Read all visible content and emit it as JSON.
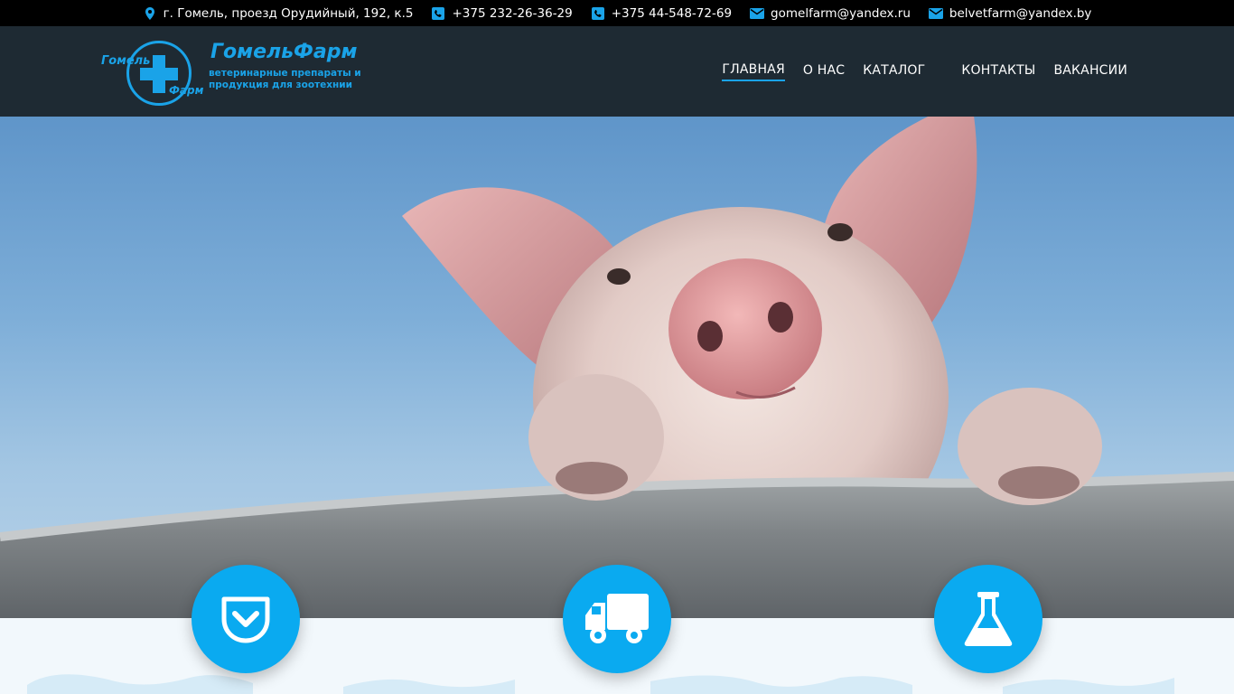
{
  "topbar": {
    "address": "г. Гомель, проезд Орудийный, 192, к.5",
    "phone1": "+375 232-26-36-29",
    "phone2": "+375 44-548-72-69",
    "email1": "gomelfarm@yandex.ru",
    "email2": "belvetfarm@yandex.by",
    "icons": [
      "map-marker-icon",
      "phone-icon",
      "phone-icon",
      "envelope-icon",
      "envelope-icon"
    ]
  },
  "logo": {
    "word_left": "Гомель",
    "word_right": "Фарм",
    "title": "ГомельФарм",
    "subtitle_line1": "ветеринарные препараты и",
    "subtitle_line2": "продукция для зоотехнии"
  },
  "nav": {
    "items": [
      {
        "label": "ГЛАВНАЯ",
        "active": true
      },
      {
        "label": "О НАС",
        "active": false
      },
      {
        "label": "КАТАЛОГ",
        "active": false
      },
      {
        "label": "КОНТАКТЫ",
        "active": false
      },
      {
        "label": "ВАКАНСИИ",
        "active": false
      }
    ]
  },
  "hero": {
    "image": "piglet-looking-over-metal-trough-photo"
  },
  "features": [
    {
      "icon": "pocket-icon"
    },
    {
      "icon": "truck-icon"
    },
    {
      "icon": "flask-icon"
    }
  ],
  "colors": {
    "accent": "#1aa3e8",
    "topbar_bg": "#000000",
    "header_bg": "#1e2a33",
    "feature_bg": "#0aaaf0",
    "bottom_bg": "#f2f8fc"
  }
}
